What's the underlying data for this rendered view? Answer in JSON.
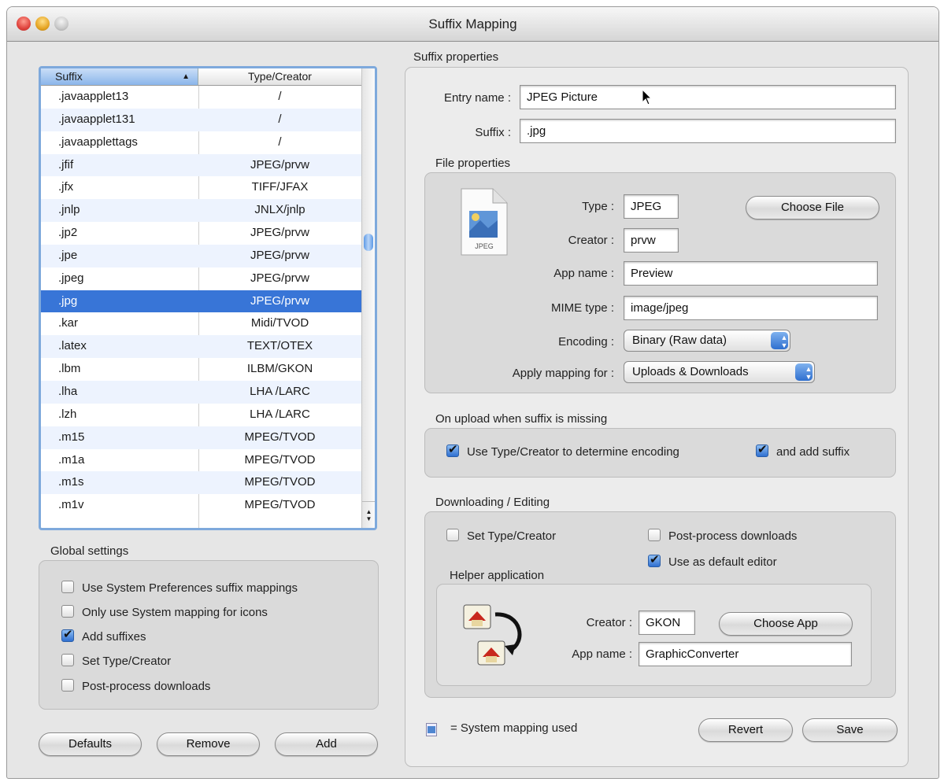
{
  "window": {
    "title": "Suffix Mapping",
    "traffic_lights": {
      "close": "#e0443e",
      "minimize": "#e6a524",
      "zoom": "#c9c9c9"
    }
  },
  "table": {
    "headers": {
      "suffix": "Suffix",
      "type_creator": "Type/Creator",
      "sort_icon": "▲"
    },
    "rows": [
      {
        "suffix": ".javaapplet13",
        "type": "/"
      },
      {
        "suffix": ".javaapplet131",
        "type": "/"
      },
      {
        "suffix": ".javaapplettags",
        "type": "/"
      },
      {
        "suffix": ".jfif",
        "type": "JPEG/prvw"
      },
      {
        "suffix": ".jfx",
        "type": "TIFF/JFAX"
      },
      {
        "suffix": ".jnlp",
        "type": "JNLX/jnlp"
      },
      {
        "suffix": ".jp2",
        "type": "JPEG/prvw"
      },
      {
        "suffix": ".jpe",
        "type": "JPEG/prvw"
      },
      {
        "suffix": ".jpeg",
        "type": "JPEG/prvw"
      },
      {
        "suffix": ".jpg",
        "type": "JPEG/prvw",
        "selected": true
      },
      {
        "suffix": ".kar",
        "type": "Midi/TVOD"
      },
      {
        "suffix": ".latex",
        "type": "TEXT/OTEX"
      },
      {
        "suffix": ".lbm",
        "type": "ILBM/GKON"
      },
      {
        "suffix": ".lha",
        "type": "LHA /LARC"
      },
      {
        "suffix": ".lzh",
        "type": "LHA /LARC"
      },
      {
        "suffix": ".m15",
        "type": "MPEG/TVOD"
      },
      {
        "suffix": ".m1a",
        "type": "MPEG/TVOD"
      },
      {
        "suffix": ".m1s",
        "type": "MPEG/TVOD"
      },
      {
        "suffix": ".m1v",
        "type": "MPEG/TVOD"
      }
    ],
    "scroll_arrows": "▲▼"
  },
  "global": {
    "title": "Global settings",
    "items": [
      {
        "label": "Use System Preferences suffix mappings",
        "checked": false
      },
      {
        "label": "Only use System mapping for icons",
        "checked": false
      },
      {
        "label": "Add suffixes",
        "checked": true
      },
      {
        "label": "Set Type/Creator",
        "checked": false
      },
      {
        "label": "Post-process downloads",
        "checked": false
      }
    ]
  },
  "buttons": {
    "defaults": "Defaults",
    "remove": "Remove",
    "add": "Add",
    "revert": "Revert",
    "save": "Save",
    "choose_file": "Choose File",
    "choose_app": "Choose App"
  },
  "suffix_props": {
    "title": "Suffix properties",
    "entry_name_label": "Entry name :",
    "entry_name": "JPEG Picture",
    "suffix_label": "Suffix :",
    "suffix": ".jpg"
  },
  "file_props": {
    "title": "File properties",
    "icon_text": "JPEG",
    "type_label": "Type :",
    "type": "JPEG",
    "creator_label": "Creator :",
    "creator": "prvw",
    "app_name_label": "App name :",
    "app_name": "Preview",
    "mime_label": "MIME type :",
    "mime": "image/jpeg",
    "encoding_label": "Encoding :",
    "encoding": "Binary (Raw data)",
    "apply_label": "Apply mapping for :",
    "apply": "Uploads & Downloads",
    "popup_arrows": "▲▼"
  },
  "upload": {
    "title": "On upload when suffix is missing",
    "use_type": "Use Type/Creator to determine encoding",
    "add_suffix": "and add suffix"
  },
  "download": {
    "title": "Downloading / Editing",
    "set_type": "Set Type/Creator",
    "post_process": "Post-process downloads",
    "default_editor": "Use as default editor",
    "helper_title": "Helper application",
    "creator_label": "Creator :",
    "creator": "GKON",
    "app_name_label": "App name :",
    "app_name": "GraphicConverter"
  },
  "footer": {
    "legend": "= System mapping used"
  }
}
